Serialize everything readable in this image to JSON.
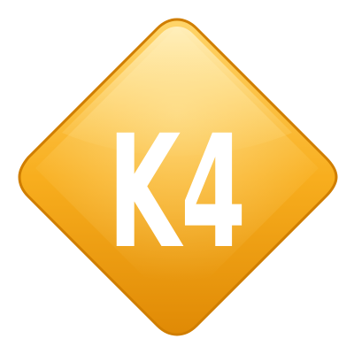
{
  "logo": {
    "text": "K4",
    "colors": {
      "diamond_light": "#FFD56A",
      "diamond_mid": "#F8AE1E",
      "diamond_dark": "#E08A05",
      "border": "#D07E00",
      "text": "#FFFFFF"
    }
  }
}
